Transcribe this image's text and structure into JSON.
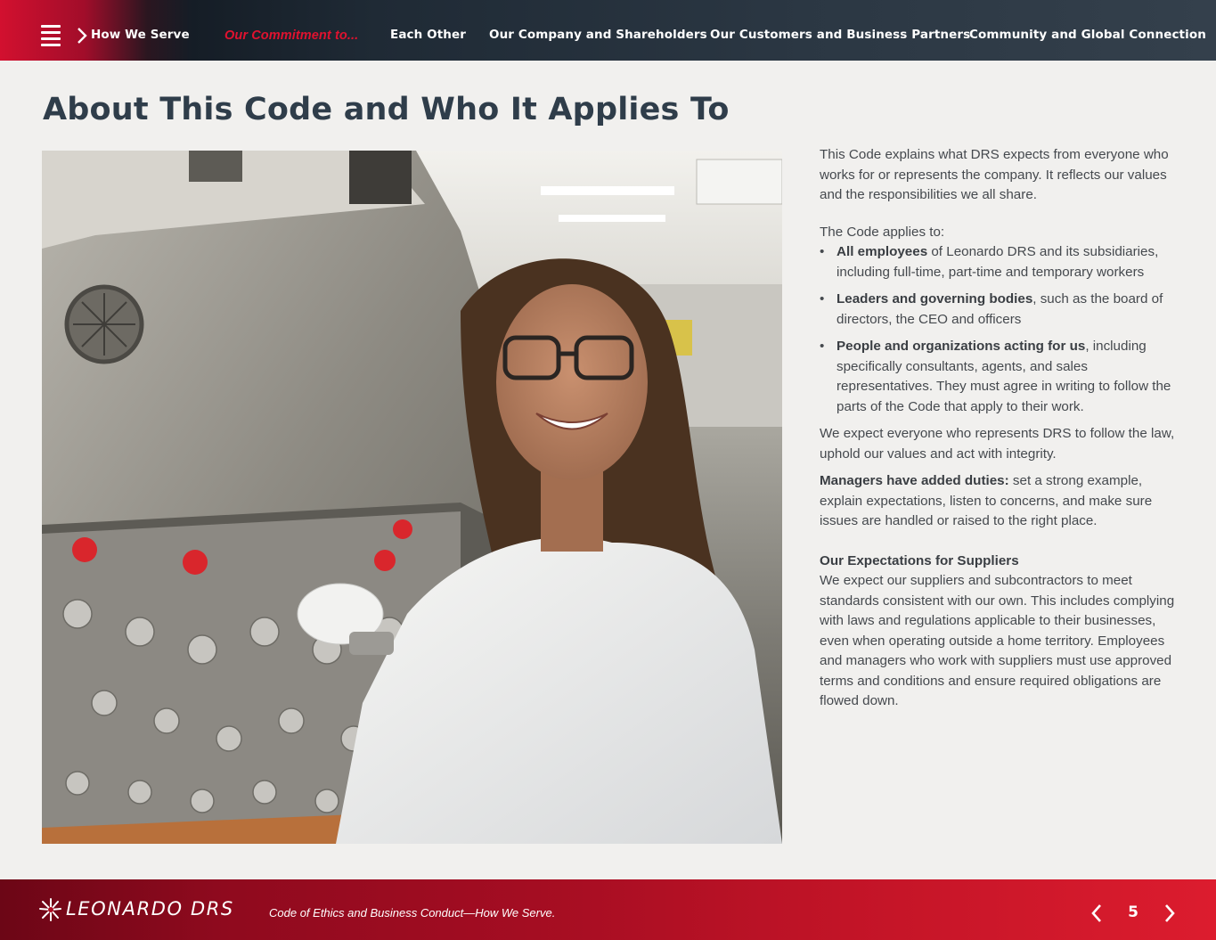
{
  "nav": {
    "how_we_serve": "How We Serve",
    "commitment": "Our Commitment to...",
    "each_other": "Each Other",
    "company": "Our Company and Shareholders",
    "customers": "Our Customers and Business Partners",
    "community": "Community and Global Connection"
  },
  "page": {
    "title": "About This Code and Who It Applies To"
  },
  "content": {
    "intro": "This Code explains what DRS expects from everyone who works for or represents the company. It reflects our values and the responsibilities we all share.",
    "applies_lead": "The Code applies to:",
    "bullets": [
      {
        "bold": "All employees",
        "rest": " of Leonardo DRS and its subsidiaries, including full-time, part-time and temporary workers"
      },
      {
        "bold": "Leaders and governing bodies",
        "rest": ", such as the board of directors, the CEO and officers"
      },
      {
        "bold": "People and organizations acting for us",
        "rest": ", including specifically consultants, agents, and sales representatives. They must agree in writing to follow the parts of the Code that apply to their work."
      }
    ],
    "expect": "We expect everyone who represents DRS to follow the law, uphold our values and act with integrity.",
    "managers_bold": "Managers have added duties:",
    "managers_rest": " set a strong example, explain expectations, listen to concerns, and make sure issues are handled or raised to the right place.",
    "suppliers_heading": "Our Expectations for Suppliers",
    "suppliers_body": "We expect our suppliers and subcontractors to meet standards consistent with our own. This includes complying with laws and regulations applicable to their businesses, even when operating outside a home territory. Employees and managers who work with suppliers must use approved terms and conditions and ensure required obligations are flowed down."
  },
  "footer": {
    "logo": "LEONARDO DRS",
    "caption": "Code of Ethics and Business Conduct—How We Serve.",
    "page_number": "5"
  },
  "colors": {
    "brand_red": "#e0122f",
    "title_slate": "#2f3d4a",
    "page_background": "#f1f0ee"
  },
  "icons": {
    "menu": "hamburger-menu-icon",
    "nav_chevron": "chevron-right-icon",
    "prev": "chevron-left-icon",
    "next": "chevron-right-icon",
    "logo": "leonardo-starburst-logo"
  }
}
